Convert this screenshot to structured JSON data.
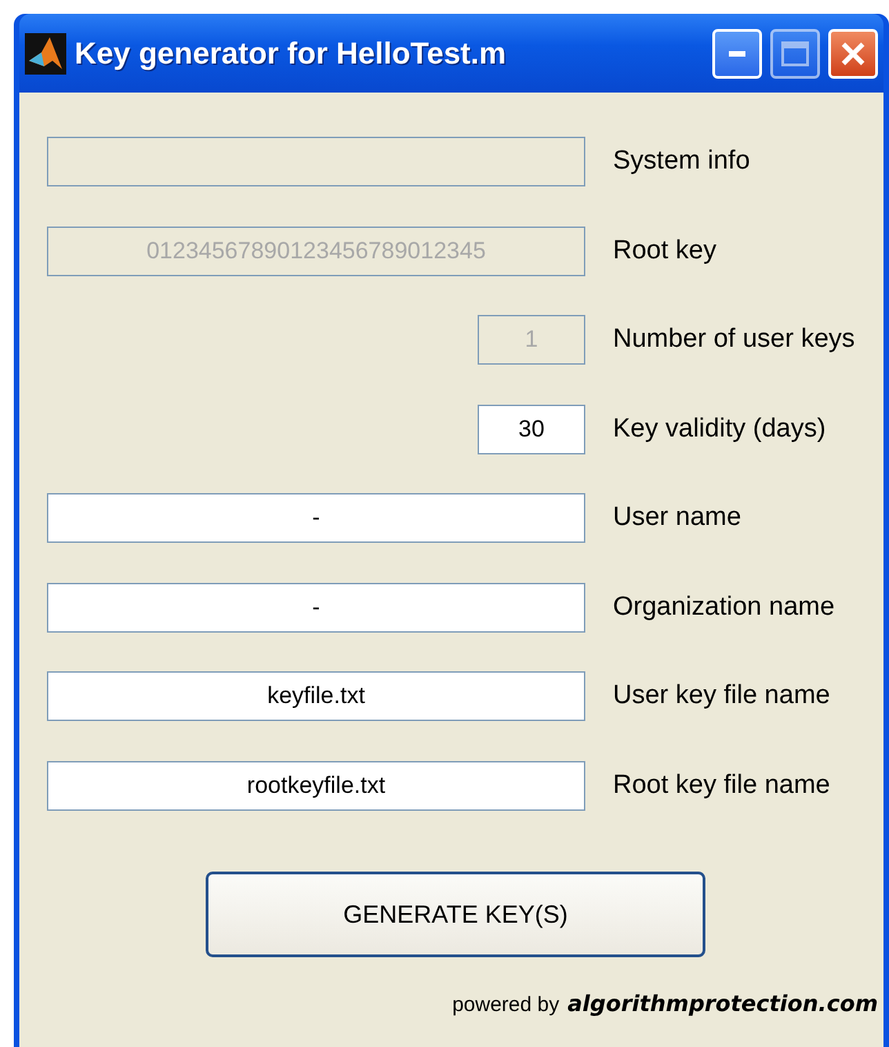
{
  "window": {
    "title": "Key generator for HelloTest.m"
  },
  "fields": [
    {
      "label": "System info",
      "kind": "wide",
      "disabled": true
    },
    {
      "label": "Root key",
      "value": "01234567890123456789012345",
      "kind": "wide",
      "disabled": true
    },
    {
      "label": "Number of user keys",
      "value": "1",
      "kind": "narrow",
      "disabled": true
    },
    {
      "label": "Key validity (days)",
      "value": "30",
      "kind": "narrow",
      "disabled": false
    },
    {
      "label": "User name",
      "value": "-",
      "kind": "wide",
      "disabled": false
    },
    {
      "label": "Organization name",
      "value": "-",
      "kind": "wide",
      "disabled": false
    },
    {
      "label": "User key file name",
      "value": "keyfile.txt",
      "kind": "wide",
      "disabled": false
    },
    {
      "label": "Root key file name",
      "value": "rootkeyfile.txt",
      "kind": "wide",
      "disabled": false
    }
  ],
  "button": "GENERATE KEY(S)",
  "footer": {
    "prefix": "powered by",
    "brand": "algorithmprotection.com"
  }
}
